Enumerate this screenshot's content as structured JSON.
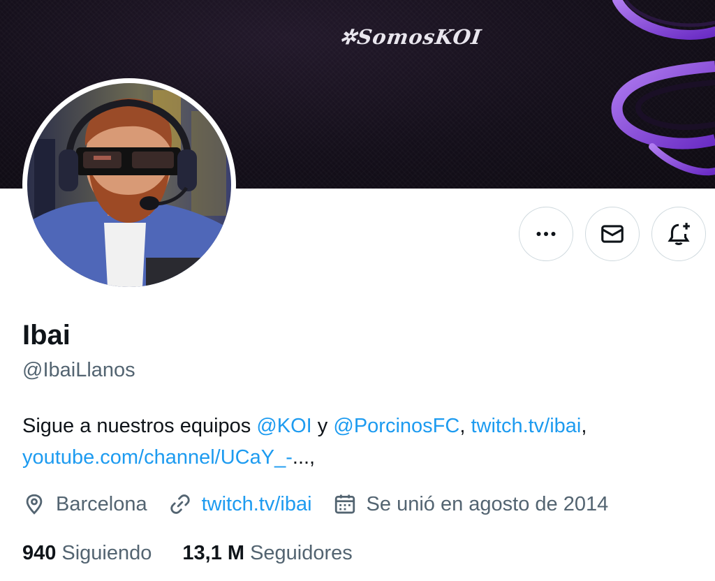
{
  "banner": {
    "tag": "✲SomosKOI"
  },
  "profile": {
    "display_name": "Ibai",
    "handle": "@IbaiLlanos",
    "bio": {
      "text_1": "Sigue a nuestros equipos ",
      "mention_1": "@KOI",
      "text_2": " y ",
      "mention_2": "@PorcinosFC",
      "text_3": ", ",
      "link_1": "twitch.tv/ibai",
      "text_4": ",",
      "link_2": "youtube.com/channel/UCaY_-",
      "text_5": "...,"
    },
    "location": "Barcelona",
    "website": "twitch.tv/ibai",
    "joined": "Se unió en agosto de 2014"
  },
  "stats": {
    "following_count": "940",
    "following_label": "Siguiendo",
    "followers_count": "13,1 M",
    "followers_label": "Seguidores"
  },
  "actions": {
    "more_icon": "more-horizontal-icon",
    "message_icon": "envelope-icon",
    "notify_icon": "bell-plus-icon"
  },
  "colors": {
    "link": "#1d9bf0",
    "secondary_text": "#536471",
    "primary_text": "#0f1419",
    "border": "#cfd9de",
    "banner_bg": "#140f1a",
    "banner_accent": "#7b3fd0"
  }
}
